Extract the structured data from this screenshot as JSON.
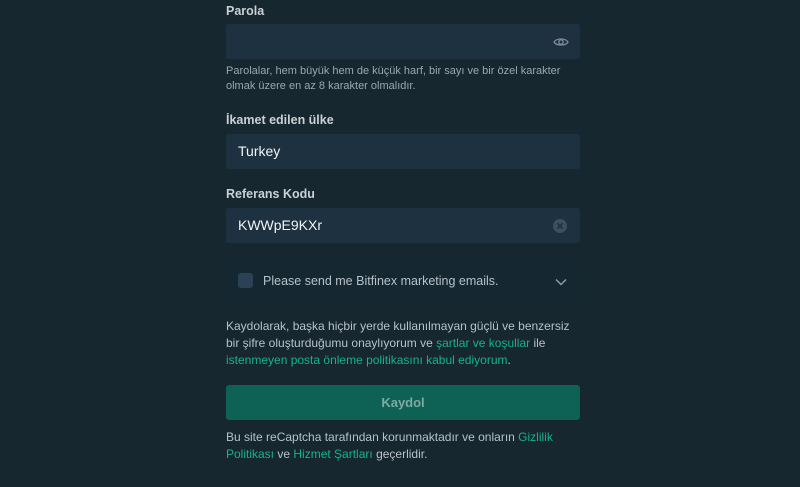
{
  "password": {
    "label": "Parola",
    "value": "",
    "hint": "Parolalar, hem büyük hem de küçük harf, bir sayı ve bir özel karakter olmak üzere en az 8 karakter olmalıdır.",
    "toggle_icon": "eye-icon"
  },
  "country": {
    "label": "İkamet edilen ülke",
    "value": "Turkey"
  },
  "referral": {
    "label": "Referans Kodu",
    "value": "KWWpE9KXr",
    "clear_icon": "clear-icon"
  },
  "marketing": {
    "label": "Please send me Bitfinex marketing emails.",
    "checked": false,
    "expand_icon": "chevron-down-icon"
  },
  "terms": {
    "text_1": "Kaydolarak, başka hiçbir yerde kullanılmayan güçlü ve benzersiz bir şifre oluşturduğumu onaylıyorum ve ",
    "link_terms": "şartlar ve koşullar",
    "text_2": " ile ",
    "link_antispam": "istenmeyen posta önleme politikasını kabul ediyorum",
    "text_3": "."
  },
  "submit": {
    "label": "Kaydol"
  },
  "recaptcha": {
    "text_1": "Bu site reCaptcha tarafından korunmaktadır ve onların ",
    "link_privacy": "Gizlilik Politikası",
    "text_2": " ve ",
    "link_terms": "Hizmet Şartları",
    "text_3": " geçerlidir."
  },
  "colors": {
    "background": "#17272f",
    "field": "#1d3140",
    "accent": "#16b389",
    "button": "#0e6255"
  }
}
